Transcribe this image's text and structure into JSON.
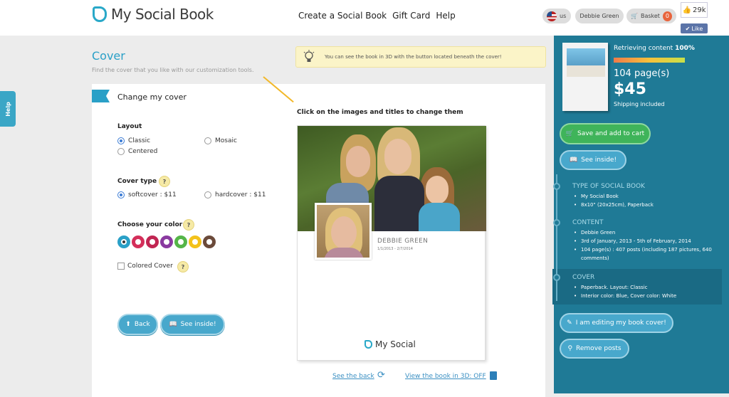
{
  "header": {
    "logo": "My Social Book",
    "nav": [
      "Create a Social Book",
      "Gift Card",
      "Help"
    ],
    "lang": "us",
    "user": "Debbie Green",
    "basket": "Basket",
    "basket_count": "0",
    "likes": "29k",
    "like_label": "Like"
  },
  "help_tab": "Help",
  "page": {
    "title": "Cover",
    "subtitle": "Find the cover that you like with our customization tools.",
    "hint": "You can see the book in 3D with the button located beneath the cover!"
  },
  "editor": {
    "heading": "Change my cover",
    "layout_label": "Layout",
    "layouts": [
      "Classic",
      "Mosaic",
      "Centered"
    ],
    "cover_type_label": "Cover type",
    "cover_types": [
      "softcover : $11",
      "hardcover : $11"
    ],
    "color_label": "Choose your color",
    "colors": [
      "#2aa0c7",
      "#d42f5a",
      "#c12552",
      "#8a3aa0",
      "#55b548",
      "#f3c21b",
      "#6b4a3a"
    ],
    "colored_cover": "Colored Cover",
    "q": "?",
    "back": "Back",
    "see_inside": "See inside!"
  },
  "preview": {
    "instruction": "Click on the images and titles to change them",
    "name": "DEBBIE GREEN",
    "dates": "1/1/2013 - 2/7/2014",
    "brand": "My Social",
    "see_back": "See the back",
    "view_3d": "View the book in 3D: OFF"
  },
  "summary": {
    "retrieving": "Retrieving content",
    "percent": "100%",
    "progress": 1.0,
    "pages": "104 page(s)",
    "price": "$45",
    "shipping": "Shipping included",
    "save_cart": "Save and add to cart",
    "see_inside": "See inside!",
    "sections": [
      {
        "title": "TYPE OF SOCIAL BOOK",
        "items": [
          "My Social Book",
          "8x10\" (20x25cm), Paperback"
        ]
      },
      {
        "title": "CONTENT",
        "items": [
          "Debbie Green",
          "3rd of January, 2013 - 5th of February, 2014",
          "104 page(s) : 407 posts (including 187 pictures, 640 comments)"
        ]
      },
      {
        "title": "COVER",
        "items": [
          "Paperback. Layout: Classic",
          "Interior color: Blue, Cover color: White"
        ]
      }
    ],
    "editing": "I am editing my book cover!",
    "remove": "Remove posts"
  }
}
